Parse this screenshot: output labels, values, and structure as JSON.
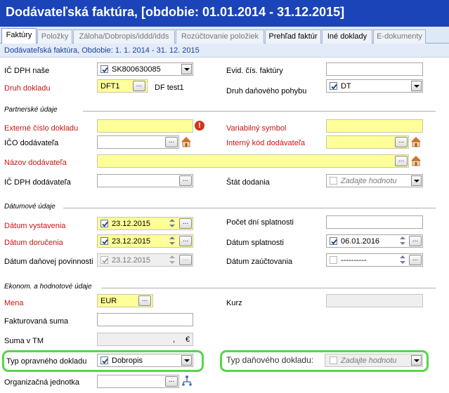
{
  "window": {
    "title": "Dodávateľská faktúra, [obdobie: 01.01.2014 - 31.12.2015]"
  },
  "tabs": [
    {
      "label": "Faktúry"
    },
    {
      "label": "Položky"
    },
    {
      "label": "Záloha/Dobropis/iddd/idds"
    },
    {
      "label": "Rozúčtovanie položiek"
    },
    {
      "label": "Prehľad faktúr"
    },
    {
      "label": "Iné doklady"
    },
    {
      "label": "E-dokumenty"
    }
  ],
  "header": {
    "text": "Dodávateľská faktúra, Obdobie: 1. 1. 2014 - 31. 12. 2015"
  },
  "fields": {
    "ic_dph_nase": {
      "label": "IČ DPH naše",
      "value": "SK800630085"
    },
    "evid_cis": {
      "label": "Evid. čís. faktúry",
      "value": ""
    },
    "druh_dokladu": {
      "label": "Druh dokladu",
      "value": "DFT1",
      "desc": "DF test1"
    },
    "druh_dan_pohybu": {
      "label": "Druh daňového pohybu",
      "value": "DT"
    },
    "ext_cislo": {
      "label": "Externé číslo dokladu",
      "value": ""
    },
    "var_symbol": {
      "label": "Variabilný symbol",
      "value": ""
    },
    "ico_dod": {
      "label": "IČO dodávateľa",
      "value": ""
    },
    "int_kod": {
      "label": "Interný kód dodávateľa",
      "value": ""
    },
    "nazov_dod": {
      "label": "Názov dodávateľa",
      "value": ""
    },
    "ic_dph_dod": {
      "label": "IČ DPH dodávateľa",
      "value": ""
    },
    "stat_dodania": {
      "label": "Štát dodania",
      "placeholder": "Zadajte hodnotu"
    },
    "datum_vyst": {
      "label": "Dátum vystavenia",
      "value": "23.12.2015"
    },
    "pocet_dni": {
      "label": "Počet dní splatnosti",
      "value": ""
    },
    "datum_dor": {
      "label": "Dátum doručenia",
      "value": "23.12.2015"
    },
    "datum_splat": {
      "label": "Dátum splatnosti",
      "value": "06.01.2016"
    },
    "datum_dan": {
      "label": "Dátum daňovej povinnosti",
      "value": "23.12.2015"
    },
    "datum_zauct": {
      "label": "Dátum zaúčtovania",
      "value": "----------"
    },
    "mena": {
      "label": "Mena",
      "value": "EUR"
    },
    "kurz": {
      "label": "Kurz",
      "value": ""
    },
    "fakt_suma": {
      "label": "Fakturovaná suma",
      "value": ""
    },
    "suma_tm": {
      "label": "Suma v TM",
      "value": ",",
      "currency": "€"
    },
    "typ_oprav": {
      "label": "Typ opravného dokladu",
      "value": "Dobropis"
    },
    "typ_dan": {
      "label": "Typ daňového dokladu:",
      "placeholder": "Zadajte hodnotu"
    },
    "org_jedn": {
      "label": "Organizačná jednotka",
      "value": ""
    }
  },
  "sections": {
    "partner": "Partnerské údaje",
    "dates": "Dátumové údaje",
    "econ": "Ekonom. a hodnotové údaje"
  },
  "buttons": {
    "ellipsis": "..."
  },
  "colors": {
    "titlebar": "#1a44b8",
    "required_label": "#cc1414",
    "required_field": "#ffff99",
    "highlight": "#55d64a"
  }
}
